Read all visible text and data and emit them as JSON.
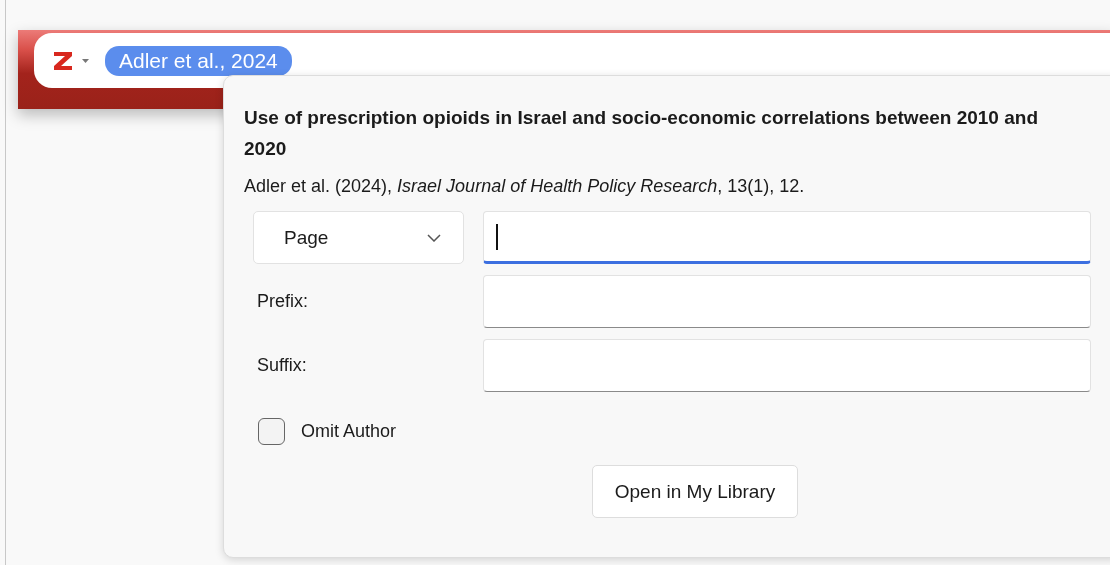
{
  "citation_bar": {
    "citation": "Adler et al., 2024"
  },
  "popup": {
    "title": "Use of prescription opioids in Israel and socio-economic correlations between 2010 and 2020",
    "reference": "Adler et al. (2024), *Israel Journal of Health Policy Research*, 13(1), 12.",
    "locator": {
      "value": "Page",
      "field_focused": true
    },
    "fields": [
      {
        "label": "Prefix:"
      },
      {
        "label": "Suffix:"
      }
    ],
    "omit_author": {
      "label": "Omit Author",
      "checked": false
    },
    "button": "Open in My Library"
  }
}
